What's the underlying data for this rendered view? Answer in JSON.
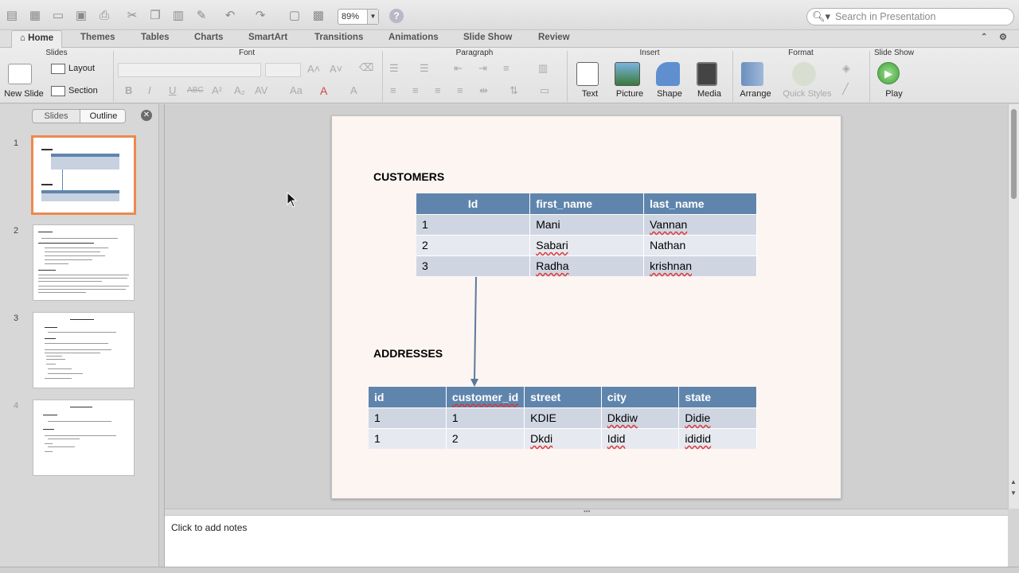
{
  "toolbar": {
    "zoom": "89%",
    "search_placeholder": "Search in Presentation"
  },
  "tabs": [
    "Home",
    "Themes",
    "Tables",
    "Charts",
    "SmartArt",
    "Transitions",
    "Animations",
    "Slide Show",
    "Review"
  ],
  "ribbon": {
    "groups": {
      "slides": "Slides",
      "font": "Font",
      "paragraph": "Paragraph",
      "insert": "Insert",
      "format": "Format",
      "slideshow": "Slide Show"
    },
    "new_slide": "New Slide",
    "layout": "Layout",
    "section": "Section",
    "text": "Text",
    "picture": "Picture",
    "shape": "Shape",
    "media": "Media",
    "arrange": "Arrange",
    "quick_styles": "Quick Styles",
    "play": "Play"
  },
  "pane": {
    "tab_slides": "Slides",
    "tab_outline": "Outline",
    "thumbs": [
      "1",
      "2",
      "3",
      "4"
    ]
  },
  "slide": {
    "customers_title": "CUSTOMERS",
    "customers": {
      "headers": [
        "Id",
        "first_name",
        "last_name"
      ],
      "rows": [
        [
          "1",
          "Mani",
          "Vannan"
        ],
        [
          "2",
          "Sabari",
          "Nathan"
        ],
        [
          "3",
          "Radha",
          "krishnan"
        ]
      ]
    },
    "addresses_title": "ADDRESSES",
    "addresses": {
      "headers": [
        "id",
        "customer_id",
        "street",
        "city",
        "state"
      ],
      "rows": [
        [
          "1",
          "1",
          "KDIE",
          "Dkdiw",
          "Didie"
        ],
        [
          "1",
          "2",
          "Dkdi",
          "Idid",
          "ididid"
        ]
      ]
    }
  },
  "notes": {
    "placeholder": "Click to add notes"
  }
}
